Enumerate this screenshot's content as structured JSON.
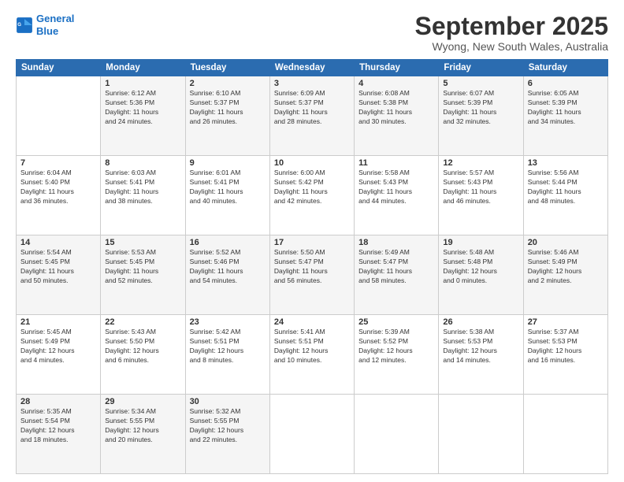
{
  "logo": {
    "line1": "General",
    "line2": "Blue"
  },
  "title": "September 2025",
  "subtitle": "Wyong, New South Wales, Australia",
  "weekdays": [
    "Sunday",
    "Monday",
    "Tuesday",
    "Wednesday",
    "Thursday",
    "Friday",
    "Saturday"
  ],
  "weeks": [
    [
      {
        "day": "",
        "info": ""
      },
      {
        "day": "1",
        "info": "Sunrise: 6:12 AM\nSunset: 5:36 PM\nDaylight: 11 hours\nand 24 minutes."
      },
      {
        "day": "2",
        "info": "Sunrise: 6:10 AM\nSunset: 5:37 PM\nDaylight: 11 hours\nand 26 minutes."
      },
      {
        "day": "3",
        "info": "Sunrise: 6:09 AM\nSunset: 5:37 PM\nDaylight: 11 hours\nand 28 minutes."
      },
      {
        "day": "4",
        "info": "Sunrise: 6:08 AM\nSunset: 5:38 PM\nDaylight: 11 hours\nand 30 minutes."
      },
      {
        "day": "5",
        "info": "Sunrise: 6:07 AM\nSunset: 5:39 PM\nDaylight: 11 hours\nand 32 minutes."
      },
      {
        "day": "6",
        "info": "Sunrise: 6:05 AM\nSunset: 5:39 PM\nDaylight: 11 hours\nand 34 minutes."
      }
    ],
    [
      {
        "day": "7",
        "info": "Sunrise: 6:04 AM\nSunset: 5:40 PM\nDaylight: 11 hours\nand 36 minutes."
      },
      {
        "day": "8",
        "info": "Sunrise: 6:03 AM\nSunset: 5:41 PM\nDaylight: 11 hours\nand 38 minutes."
      },
      {
        "day": "9",
        "info": "Sunrise: 6:01 AM\nSunset: 5:41 PM\nDaylight: 11 hours\nand 40 minutes."
      },
      {
        "day": "10",
        "info": "Sunrise: 6:00 AM\nSunset: 5:42 PM\nDaylight: 11 hours\nand 42 minutes."
      },
      {
        "day": "11",
        "info": "Sunrise: 5:58 AM\nSunset: 5:43 PM\nDaylight: 11 hours\nand 44 minutes."
      },
      {
        "day": "12",
        "info": "Sunrise: 5:57 AM\nSunset: 5:43 PM\nDaylight: 11 hours\nand 46 minutes."
      },
      {
        "day": "13",
        "info": "Sunrise: 5:56 AM\nSunset: 5:44 PM\nDaylight: 11 hours\nand 48 minutes."
      }
    ],
    [
      {
        "day": "14",
        "info": "Sunrise: 5:54 AM\nSunset: 5:45 PM\nDaylight: 11 hours\nand 50 minutes."
      },
      {
        "day": "15",
        "info": "Sunrise: 5:53 AM\nSunset: 5:45 PM\nDaylight: 11 hours\nand 52 minutes."
      },
      {
        "day": "16",
        "info": "Sunrise: 5:52 AM\nSunset: 5:46 PM\nDaylight: 11 hours\nand 54 minutes."
      },
      {
        "day": "17",
        "info": "Sunrise: 5:50 AM\nSunset: 5:47 PM\nDaylight: 11 hours\nand 56 minutes."
      },
      {
        "day": "18",
        "info": "Sunrise: 5:49 AM\nSunset: 5:47 PM\nDaylight: 11 hours\nand 58 minutes."
      },
      {
        "day": "19",
        "info": "Sunrise: 5:48 AM\nSunset: 5:48 PM\nDaylight: 12 hours\nand 0 minutes."
      },
      {
        "day": "20",
        "info": "Sunrise: 5:46 AM\nSunset: 5:49 PM\nDaylight: 12 hours\nand 2 minutes."
      }
    ],
    [
      {
        "day": "21",
        "info": "Sunrise: 5:45 AM\nSunset: 5:49 PM\nDaylight: 12 hours\nand 4 minutes."
      },
      {
        "day": "22",
        "info": "Sunrise: 5:43 AM\nSunset: 5:50 PM\nDaylight: 12 hours\nand 6 minutes."
      },
      {
        "day": "23",
        "info": "Sunrise: 5:42 AM\nSunset: 5:51 PM\nDaylight: 12 hours\nand 8 minutes."
      },
      {
        "day": "24",
        "info": "Sunrise: 5:41 AM\nSunset: 5:51 PM\nDaylight: 12 hours\nand 10 minutes."
      },
      {
        "day": "25",
        "info": "Sunrise: 5:39 AM\nSunset: 5:52 PM\nDaylight: 12 hours\nand 12 minutes."
      },
      {
        "day": "26",
        "info": "Sunrise: 5:38 AM\nSunset: 5:53 PM\nDaylight: 12 hours\nand 14 minutes."
      },
      {
        "day": "27",
        "info": "Sunrise: 5:37 AM\nSunset: 5:53 PM\nDaylight: 12 hours\nand 16 minutes."
      }
    ],
    [
      {
        "day": "28",
        "info": "Sunrise: 5:35 AM\nSunset: 5:54 PM\nDaylight: 12 hours\nand 18 minutes."
      },
      {
        "day": "29",
        "info": "Sunrise: 5:34 AM\nSunset: 5:55 PM\nDaylight: 12 hours\nand 20 minutes."
      },
      {
        "day": "30",
        "info": "Sunrise: 5:32 AM\nSunset: 5:55 PM\nDaylight: 12 hours\nand 22 minutes."
      },
      {
        "day": "",
        "info": ""
      },
      {
        "day": "",
        "info": ""
      },
      {
        "day": "",
        "info": ""
      },
      {
        "day": "",
        "info": ""
      }
    ]
  ]
}
